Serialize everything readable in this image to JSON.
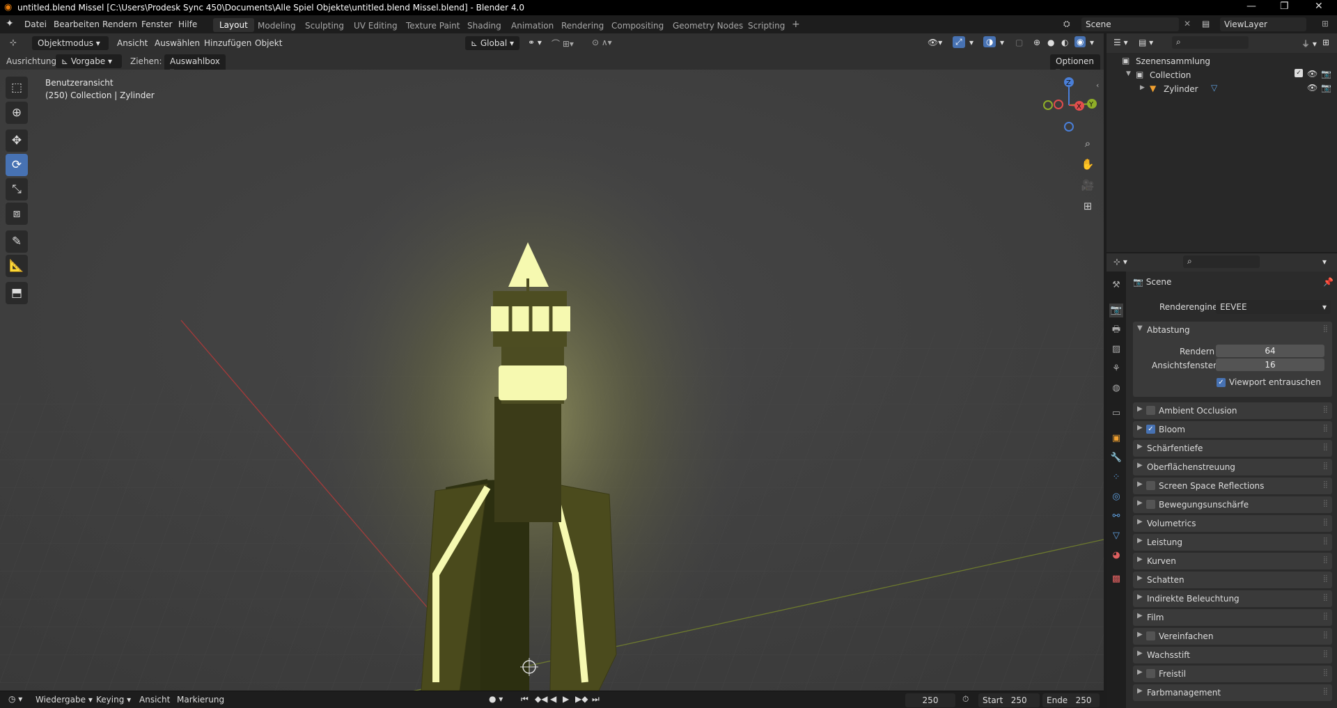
{
  "window": {
    "title": "untitled.blend Missel [C:\\Users\\Prodesk Sync 450\\Documents\\Alle Spiel Objekte\\untitled.blend Missel.blend] - Blender 4.0",
    "minimize": "—",
    "maximize": "❐",
    "close": "✕"
  },
  "menu": [
    "Datei",
    "Bearbeiten",
    "Rendern",
    "Fenster",
    "Hilfe"
  ],
  "workspaces": [
    "Layout",
    "Modeling",
    "Sculpting",
    "UV Editing",
    "Texture Paint",
    "Shading",
    "Animation",
    "Rendering",
    "Compositing",
    "Geometry Nodes",
    "Scripting"
  ],
  "workspace_add": "+",
  "scene": {
    "label": "Scene",
    "viewlayer": "ViewLayer"
  },
  "viewport_header": {
    "mode": "Objektmodus",
    "items": [
      "Ansicht",
      "Auswählen",
      "Hinzufügen",
      "Objekt"
    ],
    "transform": "Global"
  },
  "tool_settings": {
    "orientation_label": "Ausrichtung:",
    "orientation_value": "Vorgabe",
    "drag_label": "Ziehen:",
    "drag_value": "Auswahlbox",
    "options": "Optionen"
  },
  "viewport_info": {
    "view_name": "Benutzeransicht",
    "object_info": "(250) Collection | Zylinder"
  },
  "gizmo": {
    "x": "X",
    "y": "Y",
    "z": "Z"
  },
  "timeline": {
    "playback": "Wiedergabe",
    "keying": "Keying",
    "view": "Ansicht",
    "marker": "Markierung",
    "current_frame": "250",
    "start_label": "Start",
    "start": "250",
    "end_label": "Ende",
    "end": "250"
  },
  "outliner": {
    "root": "Szenensammlung",
    "collection": "Collection",
    "object": "Zylinder"
  },
  "properties": {
    "scene": "Scene",
    "render_engine_label": "Renderengine",
    "render_engine": "EEVEE",
    "sampling": "Abtastung",
    "render_label": "Rendern",
    "render_samples": "64",
    "viewport_label": "Ansichtsfenster",
    "viewport_samples": "16",
    "denoise": "Viewport entrauschen",
    "panels": [
      {
        "label": "Ambient Occlusion",
        "checkbox": true,
        "checked": false
      },
      {
        "label": "Bloom",
        "checkbox": true,
        "checked": true
      },
      {
        "label": "Schärfentiefe",
        "checkbox": false,
        "checked": false
      },
      {
        "label": "Oberflächenstreuung",
        "checkbox": false,
        "checked": false
      },
      {
        "label": "Screen Space Reflections",
        "checkbox": true,
        "checked": false
      },
      {
        "label": "Bewegungsunschärfe",
        "checkbox": true,
        "checked": false
      },
      {
        "label": "Volumetrics",
        "checkbox": false,
        "checked": false
      },
      {
        "label": "Leistung",
        "checkbox": false,
        "checked": false
      },
      {
        "label": "Kurven",
        "checkbox": false,
        "checked": false
      },
      {
        "label": "Schatten",
        "checkbox": false,
        "checked": false
      },
      {
        "label": "Indirekte Beleuchtung",
        "checkbox": false,
        "checked": false
      },
      {
        "label": "Film",
        "checkbox": false,
        "checked": false
      },
      {
        "label": "Vereinfachen",
        "checkbox": true,
        "checked": false
      },
      {
        "label": "Wachsstift",
        "checkbox": false,
        "checked": false
      },
      {
        "label": "Freistil",
        "checkbox": true,
        "checked": false
      },
      {
        "label": "Farbmanagement",
        "checkbox": false,
        "checked": false
      }
    ]
  },
  "colors": {
    "accent": "#4772b3",
    "glow": "#f4f7a0",
    "viewport_bg": "#3d3d3d"
  }
}
